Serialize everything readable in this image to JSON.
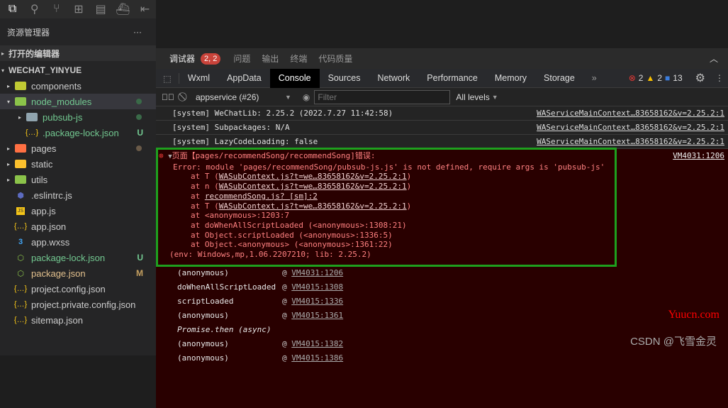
{
  "activity_icons": [
    "explorer-icon",
    "search-icon",
    "source-control-icon",
    "extensions-icon",
    "database-icon",
    "docker-icon",
    "collapse-icon"
  ],
  "sidebar": {
    "title": "资源管理器",
    "more": "···",
    "open_editors": "打开的编辑器",
    "project": "WECHAT_YINYUE",
    "items": [
      {
        "label": "components",
        "type": "folder",
        "color": "#c0ca33",
        "arrow": "▸"
      },
      {
        "label": "node_modules",
        "type": "folder",
        "color": "#8bc34a",
        "arrow": "▾",
        "status": "dot",
        "git": true
      },
      {
        "label": "pubsub-js",
        "type": "folder",
        "color": "#90a4ae",
        "arrow": "▸",
        "indent": 1,
        "status": "dot",
        "git": true
      },
      {
        "label": ".package-lock.json",
        "type": "json",
        "indent": 1,
        "badge": "U",
        "git": true
      },
      {
        "label": "pages",
        "type": "folder",
        "color": "#ff7043",
        "arrow": "▸",
        "status": "dot-brown"
      },
      {
        "label": "static",
        "type": "folder",
        "color": "#fbc02d",
        "arrow": "▸"
      },
      {
        "label": "utils",
        "type": "folder",
        "color": "#8bc34a",
        "arrow": "▸"
      },
      {
        "label": ".eslintrc.js",
        "type": "eslint"
      },
      {
        "label": "app.js",
        "type": "js"
      },
      {
        "label": "app.json",
        "type": "json"
      },
      {
        "label": "app.wxss",
        "type": "css"
      },
      {
        "label": "package-lock.json",
        "type": "node",
        "badge": "U",
        "git": true
      },
      {
        "label": "package.json",
        "type": "node",
        "badge": "M",
        "mod": true
      },
      {
        "label": "project.config.json",
        "type": "json"
      },
      {
        "label": "project.private.config.json",
        "type": "json"
      },
      {
        "label": "sitemap.json",
        "type": "json"
      }
    ]
  },
  "panel": {
    "tabs": [
      "调试器",
      "问题",
      "输出",
      "终端",
      "代码质量"
    ],
    "count": "2, 2"
  },
  "devtools": {
    "tabs": [
      "Wxml",
      "AppData",
      "Console",
      "Sources",
      "Network",
      "Performance",
      "Memory",
      "Storage"
    ],
    "active": "Console",
    "more": "»",
    "errors": "2",
    "warnings": "2",
    "info": "13"
  },
  "filterbar": {
    "context": "appservice (#26)",
    "filter_placeholder": "Filter",
    "levels": "All levels"
  },
  "logs": [
    {
      "text": "[system] WeChatLib: 2.25.2 (2022.7.27 11:42:58)",
      "src": "WAServiceMainContext…83658162&v=2.25.2:1"
    },
    {
      "text": "[system] Subpackages: N/A",
      "src": "WAServiceMainContext…83658162&v=2.25.2:1"
    },
    {
      "text": "[system] LazyCodeLoading: false",
      "src": "WAServiceMainContext…83658162&v=2.25.2:1"
    }
  ],
  "error": {
    "title": "页面【pages/recommendSong/recommendSong]错误:",
    "src": "VM4031:1206",
    "message": "Error: module 'pages/recommendSong/pubsub-js.js' is not defined, require args is 'pubsub-js'",
    "trace": [
      {
        "pre": "at T (",
        "link": "WASubContext.js?t=we…83658162&v=2.25.2:1",
        "post": ")"
      },
      {
        "pre": "at n (",
        "link": "WASubContext.js?t=we…83658162&v=2.25.2:1",
        "post": ")"
      },
      {
        "pre": "at ",
        "link": "recommendSong.js? [sm]:2",
        "post": ""
      },
      {
        "pre": "at T (",
        "link": "WASubContext.js?t=we…83658162&v=2.25.2:1",
        "post": ")"
      },
      {
        "pre": "at <anonymous>:1203:7",
        "link": "",
        "post": ""
      },
      {
        "pre": "at doWhenAllScriptLoaded (<anonymous>:1308:21)",
        "link": "",
        "post": ""
      },
      {
        "pre": "at Object.scriptLoaded (<anonymous>:1336:5)",
        "link": "",
        "post": ""
      },
      {
        "pre": "at Object.<anonymous> (<anonymous>:1361:22)",
        "link": "",
        "post": ""
      }
    ],
    "env": "(env: Windows,mp,1.06.2207210; lib: 2.25.2)"
  },
  "stack": [
    {
      "fn": "(anonymous)",
      "src": "VM4031:1206"
    },
    {
      "fn": "doWhenAllScriptLoaded",
      "src": "VM4015:1308"
    },
    {
      "fn": "scriptLoaded",
      "src": "VM4015:1336"
    },
    {
      "fn": "(anonymous)",
      "src": "VM4015:1361"
    },
    {
      "fn": "Promise.then (async)",
      "src": "",
      "italic": true
    },
    {
      "fn": "(anonymous)",
      "src": "VM4015:1382"
    },
    {
      "fn": "(anonymous)",
      "src": "VM4015:1386"
    }
  ],
  "watermarks": [
    "Yuucn.com",
    "CSDN @飞雪金灵"
  ]
}
